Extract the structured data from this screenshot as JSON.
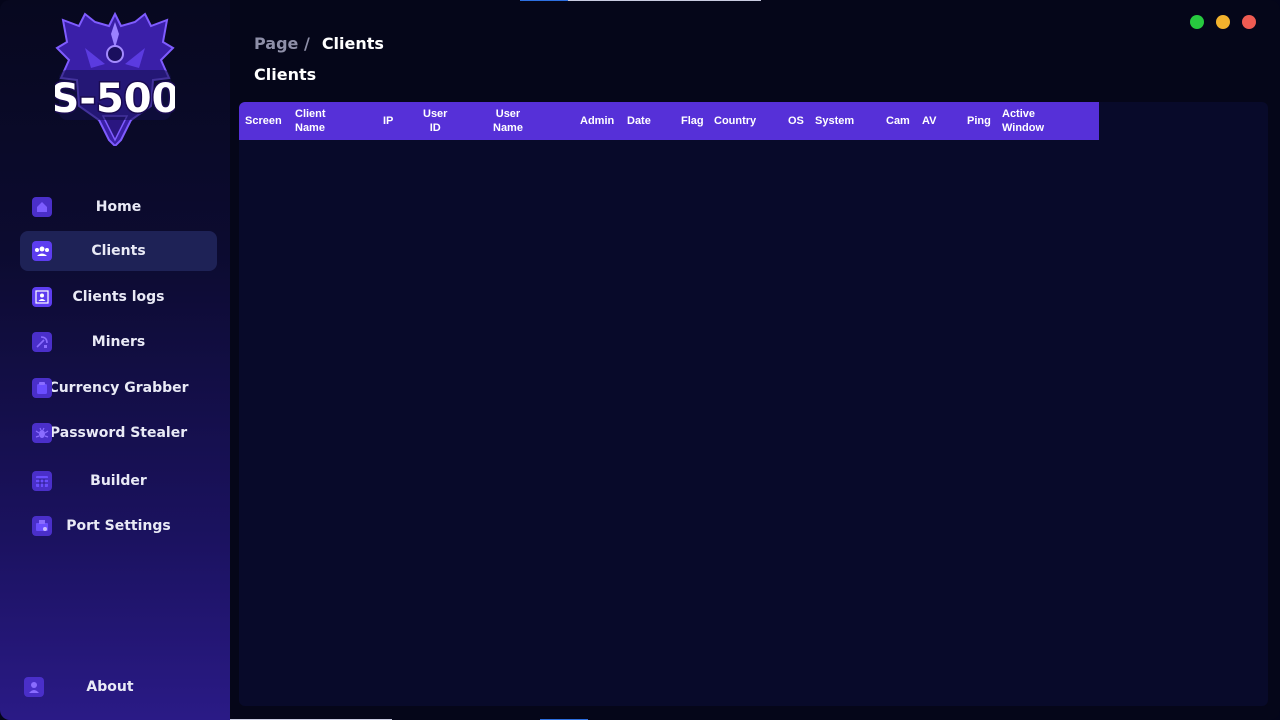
{
  "app": {
    "logo_text": "S-500",
    "colors": {
      "accent": "#5630d8",
      "sidebar_active": "#1e2256",
      "close": "#ef5b52",
      "minimize": "#f2b22d",
      "maximize": "#27c93f"
    }
  },
  "window_controls": [
    {
      "name": "maximize",
      "color": "#27c93f"
    },
    {
      "name": "minimize",
      "color": "#f2b22d"
    },
    {
      "name": "close",
      "color": "#ef5b52"
    }
  ],
  "sidebar": {
    "items": [
      {
        "label": "Home",
        "icon": "home-icon"
      },
      {
        "label": "Clients",
        "icon": "users-icon",
        "active": true
      },
      {
        "label": "Clients logs",
        "icon": "user-frame-icon"
      },
      {
        "label": "Miners",
        "icon": "pickaxe-icon"
      },
      {
        "label": "Currency Grabber",
        "icon": "wallet-icon"
      },
      {
        "label": "Password Stealer",
        "icon": "bug-icon"
      },
      {
        "label": "Builder",
        "icon": "calendar-grid-icon"
      },
      {
        "label": "Port Settings",
        "icon": "network-icon"
      },
      {
        "label": "About",
        "icon": "user-icon"
      }
    ]
  },
  "header": {
    "breadcrumb_root": "Page /",
    "breadcrumb_current": "Clients",
    "title": "Clients"
  },
  "table": {
    "columns": [
      "Screen",
      "Client\nName",
      "IP",
      "User\nID",
      "User\nName",
      "Admin",
      "Date",
      "Flag",
      "Country",
      "OS",
      "System",
      "Cam",
      "AV",
      "Ping",
      "Active\nWindow"
    ],
    "rows": []
  }
}
